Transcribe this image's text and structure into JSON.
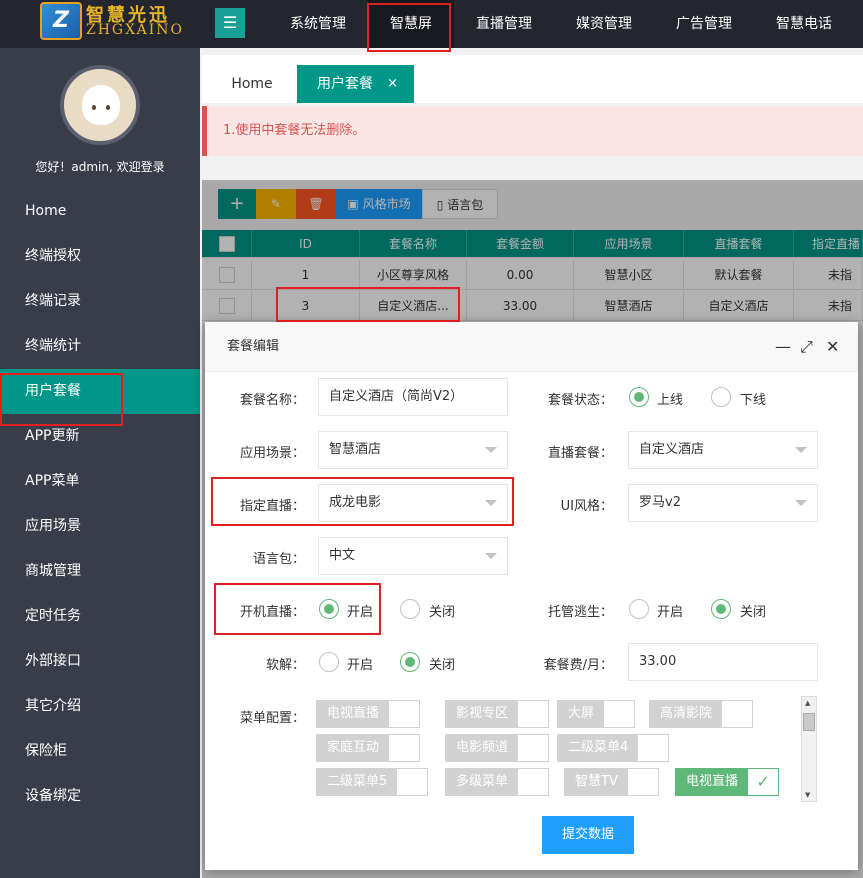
{
  "logo": {
    "mark": "Z",
    "cn": "智慧光迅",
    "en": "ZHGXAINO"
  },
  "topnav": [
    "系统管理",
    "智慧屏",
    "直播管理",
    "媒资管理",
    "广告管理",
    "智慧电话"
  ],
  "sidebar": {
    "welcome": "您好！admin, 欢迎登录",
    "items": [
      "Home",
      "终端授权",
      "终端记录",
      "终端统计",
      "用户套餐",
      "APP更新",
      "APP菜单",
      "应用场景",
      "商城管理",
      "定时任务",
      "外部接口",
      "其它介绍",
      "保险柜",
      "设备绑定"
    ]
  },
  "tabs": {
    "home": "Home",
    "active": "用户套餐",
    "close": "×"
  },
  "notice": "1.使用中套餐无法删除。",
  "toolbar": {
    "add": "+",
    "style": "风格市场",
    "lang": "语言包"
  },
  "table": {
    "headers": [
      "ID",
      "套餐名称",
      "套餐金额",
      "应用场景",
      "直播套餐",
      "指定直播"
    ],
    "rows": [
      [
        "1",
        "小区尊享风格",
        "0.00",
        "智慧小区",
        "默认套餐",
        "未指"
      ],
      [
        "3",
        "自定义酒店...",
        "33.00",
        "智慧酒店",
        "自定义酒店",
        "未指"
      ]
    ]
  },
  "dialog": {
    "title": "套餐编辑",
    "fields": {
      "name_label": "套餐名称：",
      "name_value": "自定义酒店（简尚V2）",
      "status_label": "套餐状态：",
      "status_on": "上线",
      "status_off": "下线",
      "scene_label": "应用场景：",
      "scene_value": "智慧酒店",
      "live_pkg_label": "直播套餐：",
      "live_pkg_value": "自定义酒店",
      "assigned_label": "指定直播：",
      "assigned_value": "成龙电影",
      "ui_label": "UI风格：",
      "ui_value": "罗马v2",
      "lang_label": "语言包：",
      "lang_value": "中文",
      "boot_label": "开机直播：",
      "boot_on": "开启",
      "boot_off": "关闭",
      "escape_label": "托管逃生：",
      "escape_on": "开启",
      "escape_off": "关闭",
      "decode_label": "软解：",
      "decode_on": "开启",
      "decode_off": "关闭",
      "fee_label": "套餐费/月：",
      "fee_value": "33.00",
      "menu_label": "菜单配置："
    },
    "menus": [
      {
        "label": "电视直播",
        "on": false
      },
      {
        "label": "影视专区",
        "on": false
      },
      {
        "label": "大屏",
        "on": false
      },
      {
        "label": "高清影院",
        "on": false
      },
      {
        "label": "家庭互动",
        "on": false
      },
      {
        "label": "电影频道",
        "on": false
      },
      {
        "label": "二级菜单4",
        "on": false
      },
      {
        "label": "二级菜单5",
        "on": false
      },
      {
        "label": "多级菜单",
        "on": false
      },
      {
        "label": "智慧TV",
        "on": false
      },
      {
        "label": "电视直播",
        "on": true
      }
    ],
    "check": "✓",
    "submit": "提交数据"
  },
  "colors": {
    "topbar": "#23262e",
    "sidebar": "#393d49",
    "accent": "#009688",
    "primary": "#1e9fff",
    "radio_on": "#5fb878",
    "highlight_box": "#e02020"
  }
}
